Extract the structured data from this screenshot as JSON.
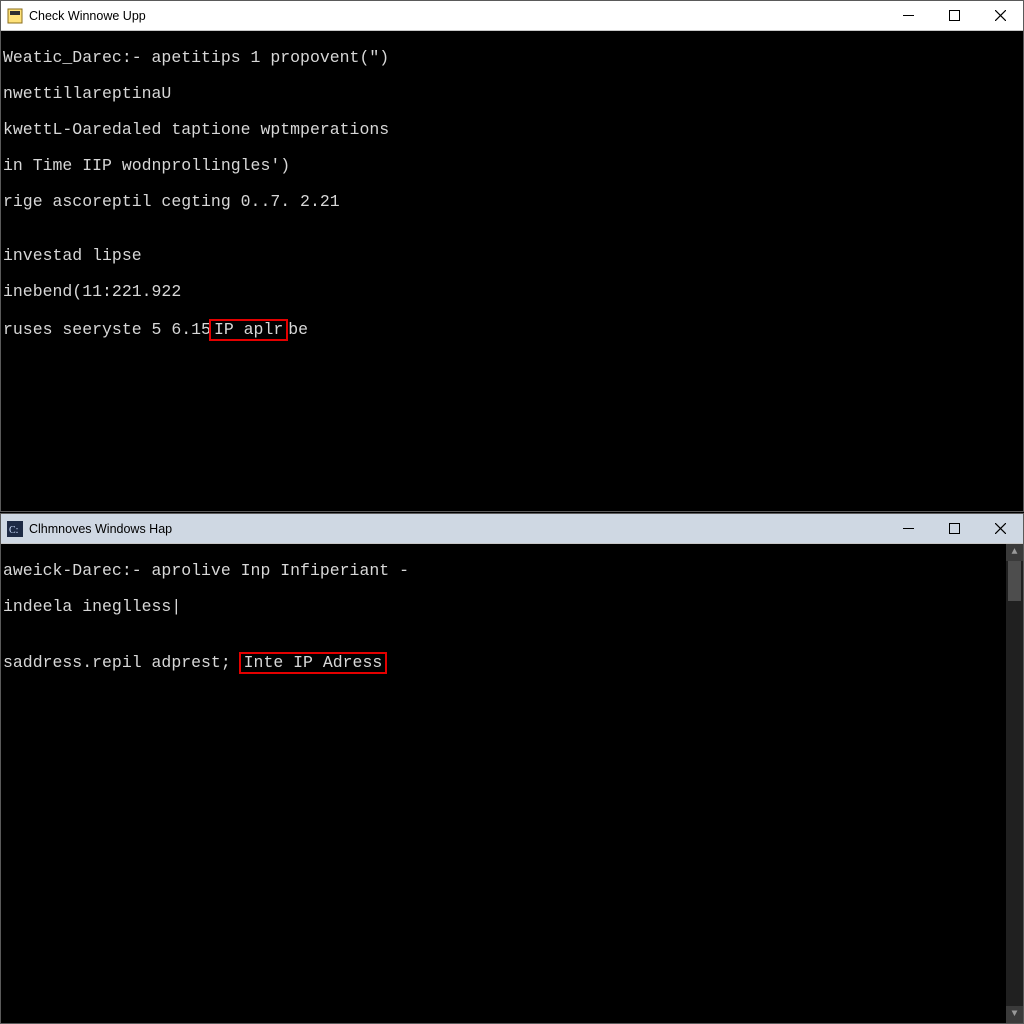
{
  "top_window": {
    "title": "Check Winnowe Upp",
    "icon": "terminal-icon",
    "lines": [
      "Weatic_Darec:- apetitips 1 propovent(\")",
      "nwettillareptinaU",
      "kwettL-Oaredaled taptione wptmperations",
      "in Time IIP wodnprollingles')",
      "rige ascoreptil cegting 0..7. 2.21",
      "",
      "investad lipse",
      "inebend(11:221.922"
    ],
    "last_line_prefix": "ruses seeryste 5 6.15",
    "last_line_highlight": "IP aplr",
    "last_line_suffix": "be"
  },
  "bottom_window": {
    "title": "Clhmnoves Windows Hap",
    "icon": "cmd-icon",
    "lines": [
      "aweick-Darec:- aprolive Inp Infiperiant -",
      "indeela ineglless|",
      ""
    ],
    "last_line_prefix": "saddress.repil adprest; ",
    "last_line_highlight": "Inte IP Adress"
  },
  "colors": {
    "highlight_border": "#e40000",
    "terminal_bg": "#000000",
    "terminal_fg": "#d7d7d7",
    "titlebar_top_bg": "#ffffff",
    "titlebar_bottom_bg": "#cfd8e3"
  }
}
